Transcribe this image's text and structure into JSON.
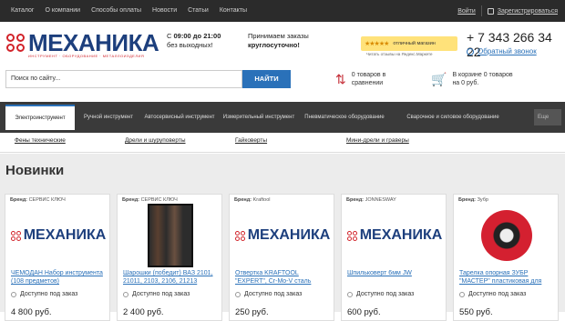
{
  "topnav": [
    "Каталог",
    "О компании",
    "Способы оплаты",
    "Новости",
    "Статьи",
    "Контакты"
  ],
  "auth": {
    "login": "Войти",
    "register": "Зарегистрироваться"
  },
  "logo": {
    "word": "МЕХАНИКА",
    "tagline": "ИНСТРУМЕНТ · ОБОРУДОВАНИЕ · МЕТАЛЛОИЗДЕЛИЯ"
  },
  "hours": {
    "line1_prefix": "С ",
    "line1_bold": "09:00 до 21:00",
    "line2": "без выходных!"
  },
  "orders": {
    "line1": "Принимаем заказы",
    "line2": "круглосуточно!"
  },
  "rating": {
    "stars": "★★★★★",
    "label": "отличный магазин",
    "sub": "Читать отзывы на Яндекс.Маркете"
  },
  "contact": {
    "phone": "+ 7 343 266 34 22",
    "callback": "Обратный звонок"
  },
  "search": {
    "placeholder": "Поиск по сайту...",
    "button": "НАЙТИ"
  },
  "compare": {
    "line1": "0 товаров в",
    "line2": "сравнении"
  },
  "cart": {
    "line1": "В корзине 0 товаров",
    "line2": "на 0 руб."
  },
  "categories": [
    "Электроинструмент",
    "Ручной инструмент",
    "Автосервисный инструмент",
    "Измерительный инструмент",
    "Пневматическое оборудование",
    "Сварочное и силовое оборудование"
  ],
  "more_label": "Еще",
  "subcategories": [
    "Фены технические",
    "Дрели и шуруповерты",
    "Гайковерты",
    "Мини-дрели и граверы"
  ],
  "section_title": "Новинки",
  "products": [
    {
      "brand_label": "Бренд:",
      "brand": "СЕРВИС КЛЮЧ",
      "name": "ЧЕМОДАН Набор инструмента (108 предметов)",
      "availability": "Доступно под заказ",
      "price": "4 800 руб.",
      "image": "logo"
    },
    {
      "brand_label": "Бренд:",
      "brand": "СЕРВИС КЛЮЧ",
      "name": "Шарошки (победит) ВАЗ 2101, 21011, 2103, 2106, 21213",
      "availability": "Доступно под заказ",
      "price": "2 400 руб.",
      "image": "tool"
    },
    {
      "brand_label": "Бренд:",
      "brand": "Kraftool",
      "name": "Отвертка KRAFTOOL \"EXPERT\", Cr-Mo-V сталь",
      "availability": "Доступно под заказ",
      "price": "250 руб.",
      "image": "logo"
    },
    {
      "brand_label": "Бренд:",
      "brand": "JONNESWAY",
      "name": "Шпильковерт 6мм JW",
      "availability": "Доступно под заказ",
      "price": "600 руб.",
      "image": "logo"
    },
    {
      "brand_label": "Бренд:",
      "brand": "Зубр",
      "name": "Тарелка опорная ЗУБР \"МАСТЕР\" пластиковая для",
      "availability": "Доступно под заказ",
      "price": "550 руб.",
      "image": "disc"
    }
  ]
}
